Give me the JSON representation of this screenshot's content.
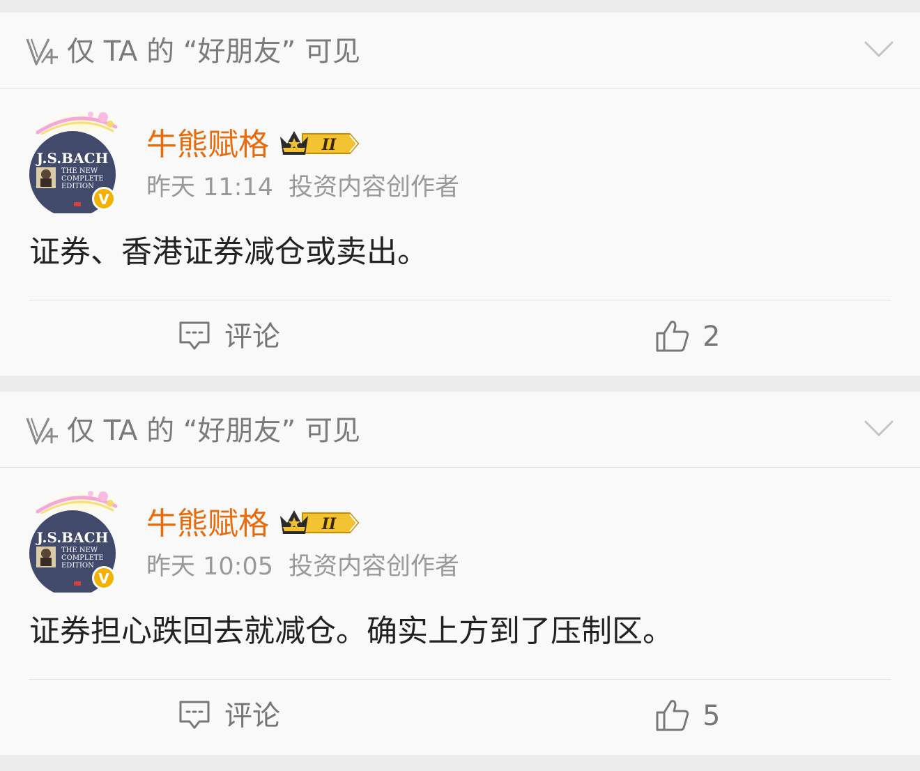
{
  "posts": [
    {
      "visibility_text": "仅 TA 的 “好朋友” 可见",
      "author_name": "牛熊赋格",
      "member_level": "II",
      "avatar_text": {
        "line1": "J.S.BACH",
        "line2": "THE NEW",
        "line3": "COMPLETE",
        "line4": "EDITION"
      },
      "verified_badge": "V",
      "time": "昨天 11:14",
      "author_tag": "投资内容创作者",
      "content": "证券、香港证券减仓或卖出。",
      "comment_label": "评论",
      "like_count": "2"
    },
    {
      "visibility_text": "仅 TA 的 “好朋友” 可见",
      "author_name": "牛熊赋格",
      "member_level": "II",
      "avatar_text": {
        "line1": "J.S.BACH",
        "line2": "THE NEW",
        "line3": "COMPLETE",
        "line4": "EDITION"
      },
      "verified_badge": "V",
      "time": "昨天 10:05",
      "author_tag": "投资内容创作者",
      "content": "证券担心跌回去就减仓。确实上方到了压制区。",
      "comment_label": "评论",
      "like_count": "5"
    }
  ],
  "icons": {
    "visibility": "friends-only-icon",
    "collapse": "chevron-down-icon",
    "comment": "comment-icon",
    "like": "thumbs-up-icon",
    "crown": "crown-icon",
    "verified": "verified-icon"
  },
  "colors": {
    "author_name": "#e86b0c",
    "meta_text": "#999999",
    "content_text": "#222222",
    "verified_badge": "#f5b100",
    "crown_gold": "#f2c230",
    "card_bg": "#f9f9f9",
    "page_bg": "#ececec"
  }
}
